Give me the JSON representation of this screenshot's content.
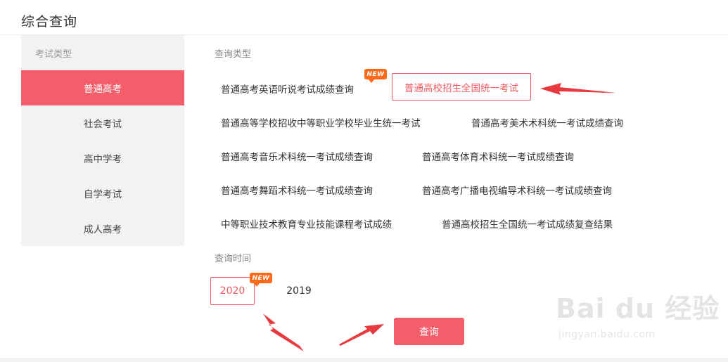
{
  "page": {
    "title": "综合查询"
  },
  "sidebar": {
    "heading": "考试类型",
    "items": [
      {
        "label": "普通高考",
        "active": true
      },
      {
        "label": "社会考试",
        "active": false
      },
      {
        "label": "高中学考",
        "active": false
      },
      {
        "label": "自学考试",
        "active": false
      },
      {
        "label": "成人高考",
        "active": false
      }
    ]
  },
  "query_type": {
    "label": "查询类型",
    "new_badge": "NEW",
    "items": [
      "普通高考英语听说考试成绩查询",
      "普通高校招生全国统一考试",
      "普通高等学校招收中等职业学校毕业生统一考试",
      "普通高考美术术科统一考试成绩查询",
      "普通高考音乐术科统一考试成绩查询",
      "普通高考体育术科统一考试成绩查询",
      "普通高考舞蹈术科统一考试成绩查询",
      "普通高考广播电视编导术科统一考试成绩查询",
      "中等职业技术教育专业技能课程考试成绩",
      "普通高校招生全国统一考试成绩复查结果"
    ],
    "selected_index": 1
  },
  "query_time": {
    "label": "查询时间",
    "new_badge": "NEW",
    "years": [
      "2020",
      "2019"
    ],
    "selected_index": 0
  },
  "submit": {
    "label": "查询"
  },
  "watermark": {
    "logo": "Bai du 经验",
    "url": "jingyan.baidu.com"
  },
  "colors": {
    "accent": "#f45d6a",
    "badge": "#ff6a1a",
    "arrow": "#e8393e",
    "sidebar_bg": "#f2f2f2"
  }
}
